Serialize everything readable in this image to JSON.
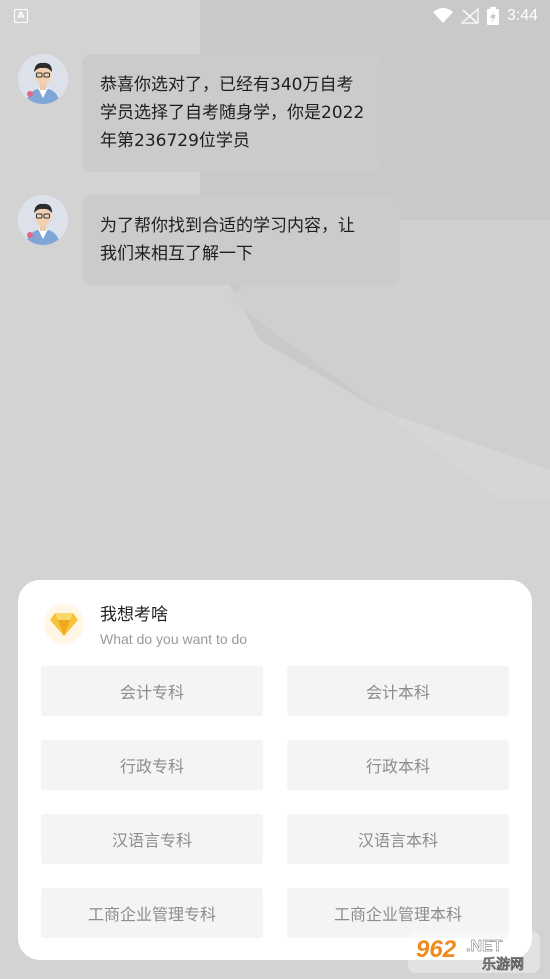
{
  "status_bar": {
    "time": "3:44",
    "left_icon": "A"
  },
  "messages": [
    {
      "lines": [
        "恭喜你选对了，已经有340万自考",
        "学员选择了自考随身学，你是2022",
        "年第236729位学员"
      ]
    },
    {
      "lines": [
        "为了帮你找到合适的学习内容，让",
        "我们来相互了解一下"
      ]
    }
  ],
  "card": {
    "title": "我想考啥",
    "subtitle": "What do you want to do",
    "options": [
      "会计专科",
      "会计本科",
      "行政专科",
      "行政本科",
      "汉语言专科",
      "汉语言本科",
      "工商企业管理专科",
      "工商企业管理本科"
    ]
  },
  "watermark": {
    "brand": "962.NET",
    "sub": "乐游网"
  },
  "colors": {
    "background": "#d3d3d4",
    "bubble": "#cbcbcc",
    "card": "#ffffff",
    "option_bg": "#f4f4f4",
    "option_text": "#8c8c8c",
    "accent": "#f5b72c"
  }
}
